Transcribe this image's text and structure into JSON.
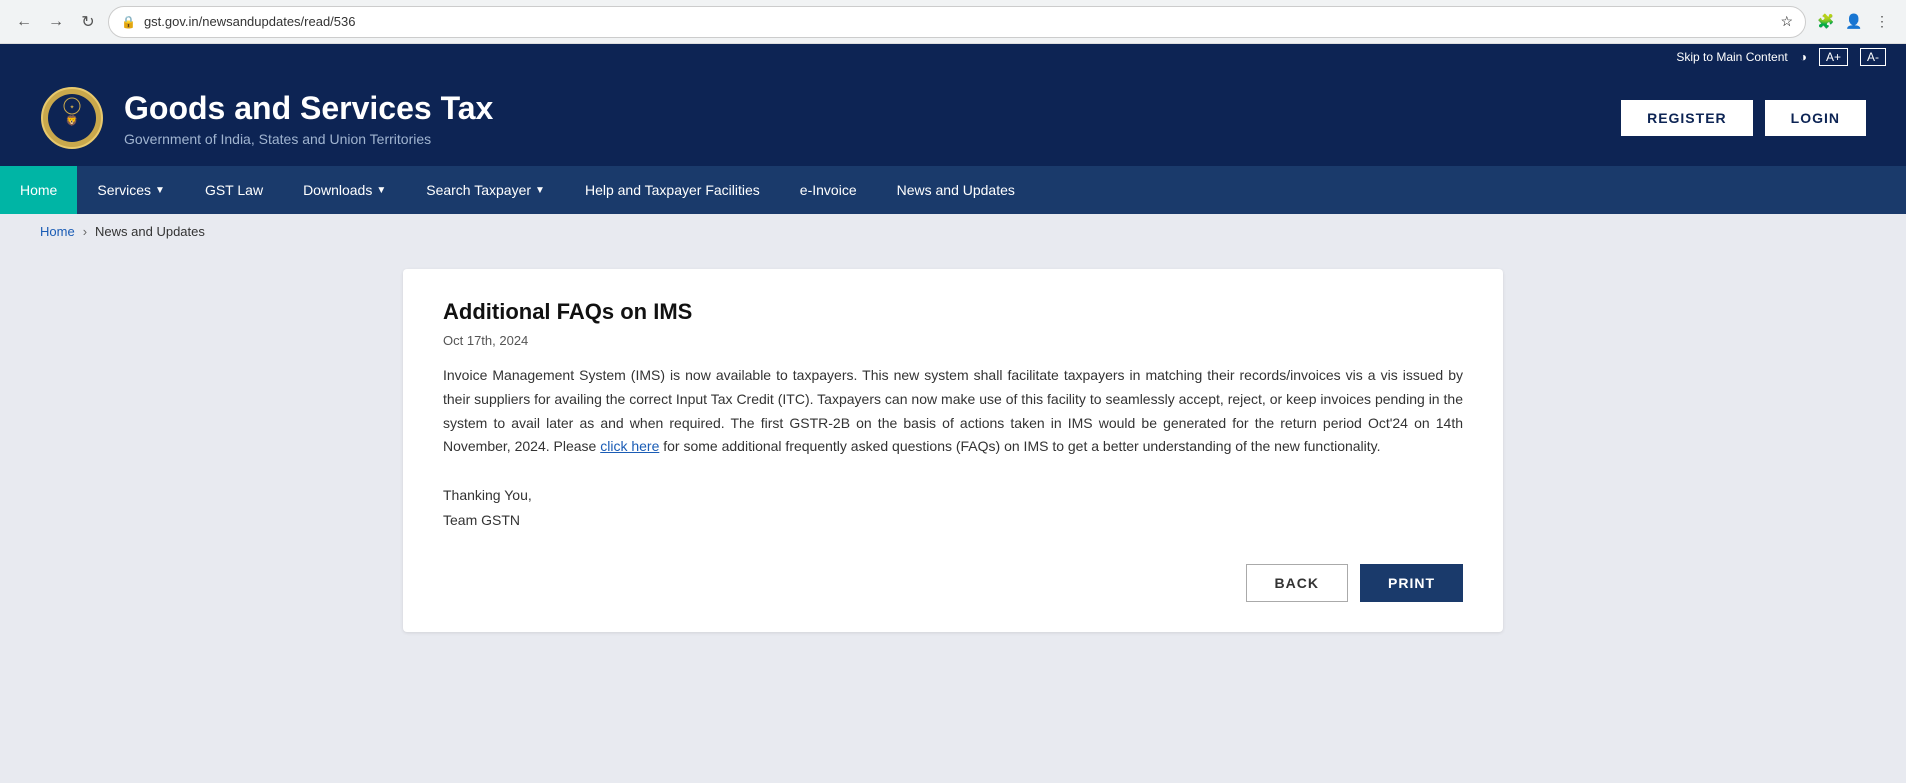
{
  "browser": {
    "url": "gst.gov.in/newsandupdates/read/536",
    "back_disabled": false,
    "forward_disabled": false
  },
  "accessibility": {
    "skip_link": "Skip to Main Content",
    "font_increase": "A+",
    "font_decrease": "A-"
  },
  "header": {
    "title": "Goods and Services Tax",
    "subtitle": "Government of India, States and Union Territories",
    "register_label": "REGISTER",
    "login_label": "LOGIN"
  },
  "nav": {
    "items": [
      {
        "label": "Home",
        "active": true,
        "has_dropdown": false
      },
      {
        "label": "Services",
        "active": false,
        "has_dropdown": true
      },
      {
        "label": "GST Law",
        "active": false,
        "has_dropdown": false
      },
      {
        "label": "Downloads",
        "active": false,
        "has_dropdown": true
      },
      {
        "label": "Search Taxpayer",
        "active": false,
        "has_dropdown": true
      },
      {
        "label": "Help and Taxpayer Facilities",
        "active": false,
        "has_dropdown": false
      },
      {
        "label": "e-Invoice",
        "active": false,
        "has_dropdown": false
      },
      {
        "label": "News and Updates",
        "active": false,
        "has_dropdown": false
      }
    ]
  },
  "breadcrumb": {
    "home": "Home",
    "separator": "›",
    "current": "News and Updates"
  },
  "article": {
    "title": "Additional FAQs on IMS",
    "date": "Oct 17th, 2024",
    "body_part1": "Invoice Management System (IMS) is now available to taxpayers. This new system shall facilitate taxpayers in matching their records/invoices vis a vis issued by their suppliers for availing the correct Input Tax Credit (ITC). Taxpayers can now make use of this facility to seamlessly accept, reject, or keep invoices pending in the system to avail later as and when required. The first GSTR-2B on the basis of actions taken in IMS would be generated for the return period Oct'24 on 14th November, 2024. Please ",
    "link_text": "click here",
    "body_part2": " for some additional frequently asked questions (FAQs) on IMS to get a better understanding of the new functionality.",
    "thanks_line1": "Thanking You,",
    "thanks_line2": "Team GSTN"
  },
  "buttons": {
    "back_label": "BACK",
    "print_label": "PRINT"
  }
}
